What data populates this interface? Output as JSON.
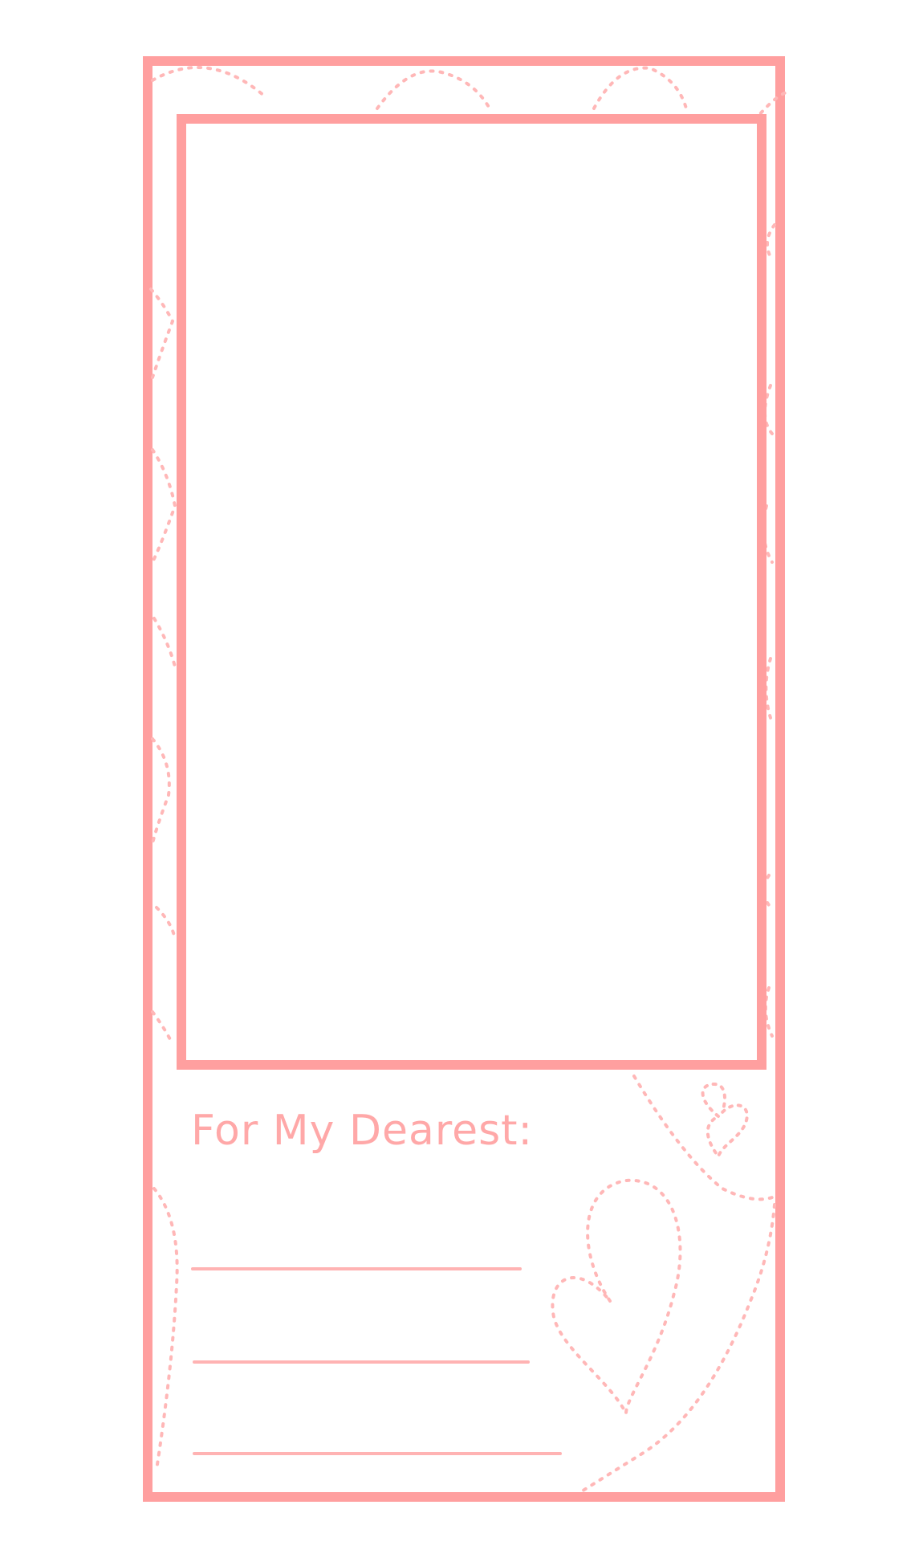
{
  "card": {
    "caption": "For My Dearest:",
    "accent_color": "#ff9f9f",
    "dotted_color": "#ffb7b7"
  },
  "photo_slot": {
    "content": ""
  },
  "writing_lines": [
    {
      "value": ""
    },
    {
      "value": ""
    },
    {
      "value": ""
    }
  ],
  "decorations": {
    "icons": [
      "dotted-heart-icon",
      "small-heart-icon",
      "dotted-swirl-pattern"
    ]
  }
}
